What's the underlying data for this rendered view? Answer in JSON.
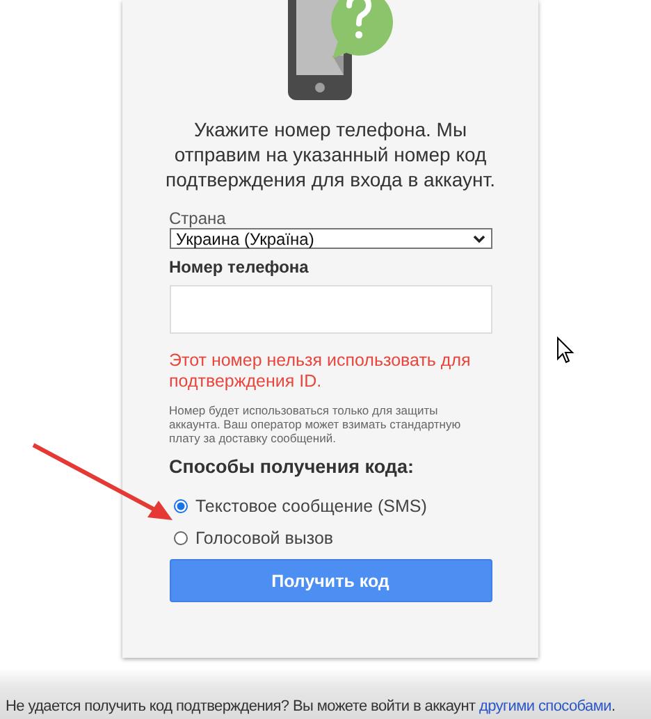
{
  "intro": "Укажите номер телефона. Мы отправим на указанный номер код подтверждения для входа в аккаунт.",
  "country": {
    "label": "Страна",
    "value": "Украина (Україна)"
  },
  "phone": {
    "label": "Номер телефона"
  },
  "error": "Этот номер нельзя использовать для подтверждения ID.",
  "note": "Номер будет использоваться только для защиты аккаунта. Ваш оператор может взимать стандартную плату за доставку сообщений.",
  "methods": {
    "title": "Способы получения кода:",
    "options": [
      {
        "label": "Текстовое сообщение (SMS)",
        "selected": true
      },
      {
        "label": "Голосовой вызов",
        "selected": false
      }
    ]
  },
  "submit": "Получить код",
  "footer": {
    "text": "Не удается получить код подтверждения? Вы можете войти в аккаунт ",
    "link": "другими способами",
    "end": "."
  }
}
